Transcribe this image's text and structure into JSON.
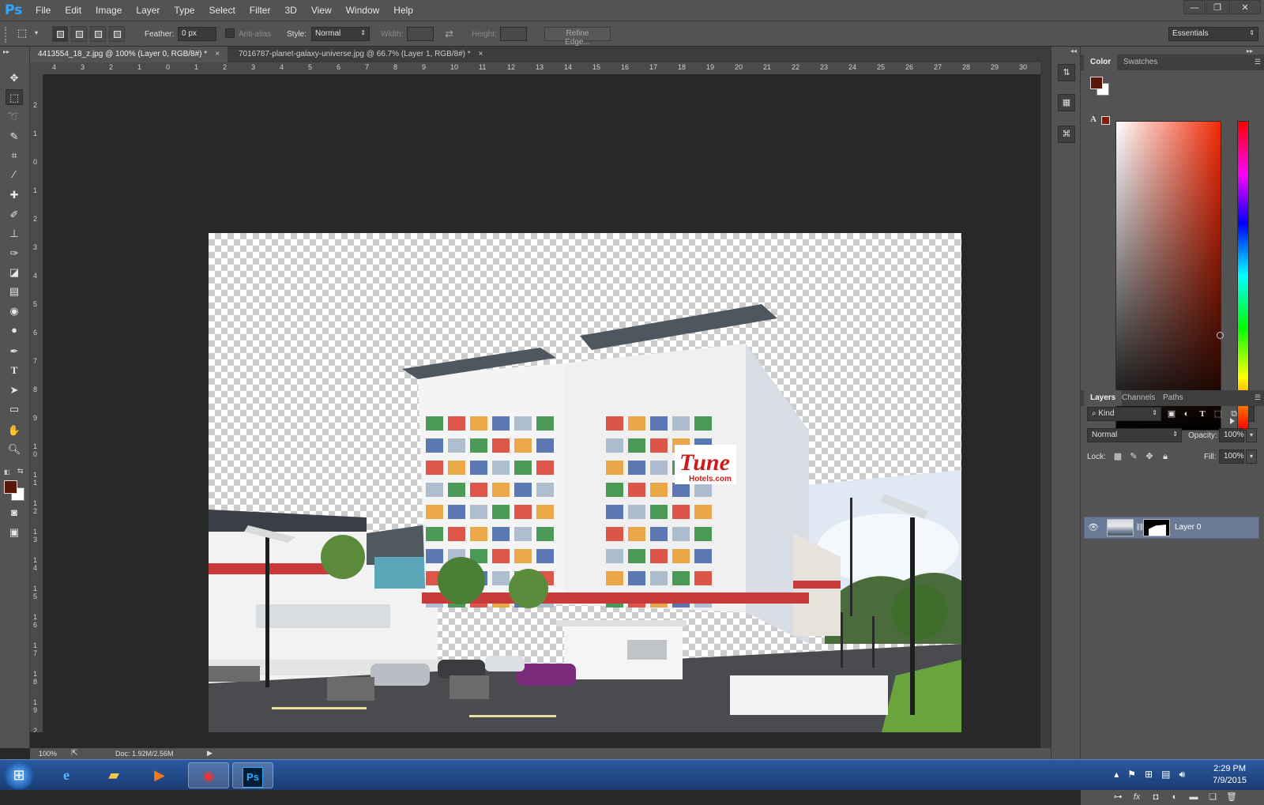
{
  "app": {
    "logo": "Ps"
  },
  "menu": [
    "File",
    "Edit",
    "Image",
    "Layer",
    "Type",
    "Select",
    "Filter",
    "3D",
    "View",
    "Window",
    "Help"
  ],
  "window_controls": {
    "minimize": "—",
    "restore": "❐",
    "close": "✕"
  },
  "options": {
    "feather_label": "Feather:",
    "feather_value": "0 px",
    "antialias_label": "Anti-alias",
    "style_label": "Style:",
    "style_value": "Normal",
    "width_label": "Width:",
    "height_label": "Height:",
    "refine_edge": "Refine Edge...",
    "workspace": "Essentials"
  },
  "tabs": [
    {
      "label": "4413554_18_z.jpg @ 100% (Layer 0, RGB/8#) *",
      "active": true
    },
    {
      "label": "7016787-planet-galaxy-universe.jpg @ 66.7% (Layer 1, RGB/8#) *",
      "active": false
    }
  ],
  "ruler_top": [
    "4",
    "3",
    "2",
    "1",
    "0",
    "1",
    "2",
    "3",
    "4",
    "5",
    "6",
    "7",
    "8",
    "9",
    "10",
    "11",
    "12",
    "13",
    "14",
    "15",
    "16",
    "17",
    "18",
    "19",
    "20",
    "21",
    "22",
    "23",
    "24",
    "25",
    "26",
    "27",
    "28",
    "29",
    "30"
  ],
  "ruler_left": [
    "2",
    "1",
    "0",
    "1",
    "2",
    "3",
    "4",
    "5",
    "6",
    "7",
    "8",
    "9",
    "1 0",
    "1 1",
    "1 2",
    "1 3",
    "1 4",
    "1 5",
    "1 6",
    "1 7",
    "1 8",
    "1 9",
    "2 0"
  ],
  "image": {
    "sign_text_1": "Tune",
    "sign_text_2": "Hotels.com"
  },
  "status": {
    "zoom": "100%",
    "doc": "Doc: 1.92M/2.56M"
  },
  "color_panel": {
    "tabs": [
      "Color",
      "Swatches"
    ],
    "foreground": "#5a1608",
    "background": "#ffffff"
  },
  "layers_panel": {
    "tabs": [
      "Layers",
      "Channels",
      "Paths"
    ],
    "kind": "Kind",
    "blend_mode": "Normal",
    "opacity_label": "Opacity:",
    "opacity_value": "100%",
    "lock_label": "Lock:",
    "fill_label": "Fill:",
    "fill_value": "100%",
    "layers": [
      {
        "name": "Layer 0",
        "visible": true,
        "selected": true
      }
    ]
  },
  "taskbar": {
    "time": "2:29 PM",
    "date": "7/9/2015"
  },
  "colors": {
    "accent": "#31a8ff",
    "panel": "#535353",
    "canvas_bg": "#282828",
    "layer_selected": "#6a7a94"
  }
}
